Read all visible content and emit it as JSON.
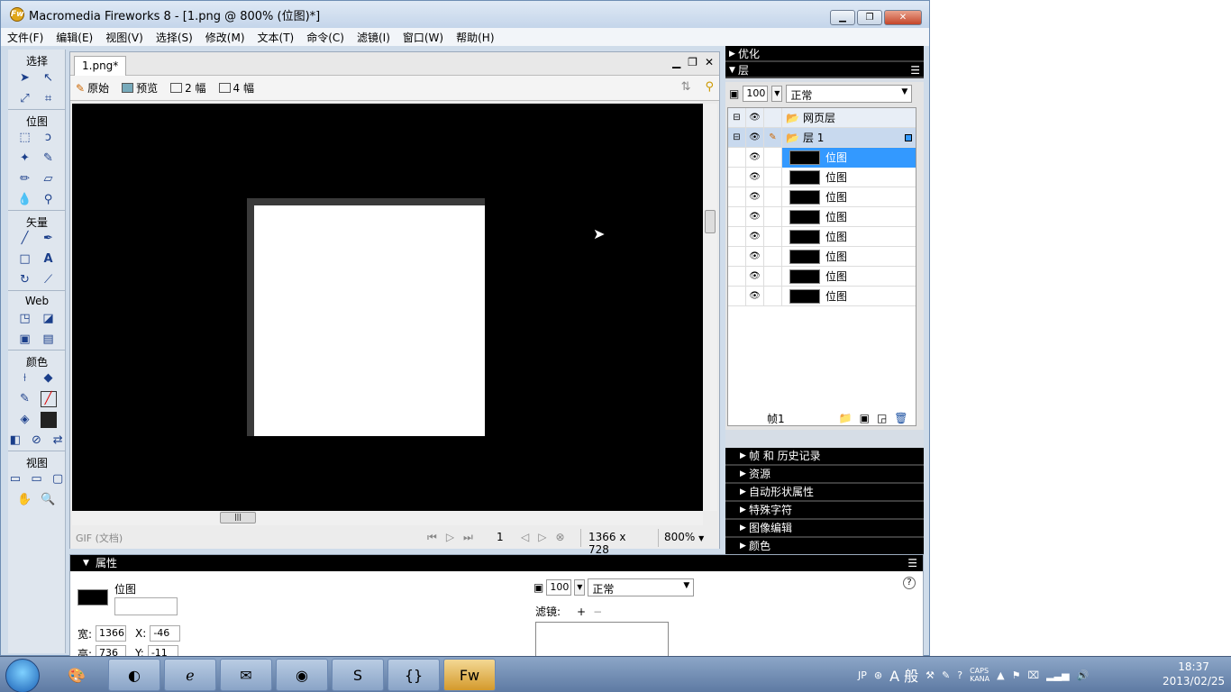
{
  "window": {
    "title": "Macromedia Fireworks 8 - [1.png @ 800% (位图)*]",
    "logo": "Fw"
  },
  "menus": [
    "文件(F)",
    "编辑(E)",
    "视图(V)",
    "选择(S)",
    "修改(M)",
    "文本(T)",
    "命令(C)",
    "滤镜(I)",
    "窗口(W)",
    "帮助(H)"
  ],
  "toolbox": {
    "sections": [
      "选择",
      "位图",
      "矢量",
      "Web",
      "颜色",
      "视图"
    ]
  },
  "document": {
    "tab": "1.png*",
    "views": [
      "原始",
      "预览",
      "2 幅",
      "4 幅"
    ],
    "status": {
      "type": "GIF (文档)",
      "frame": "1",
      "size": "1366 x 728",
      "zoom": "800%"
    }
  },
  "panels": {
    "optimize": "优化",
    "layers_title": "层",
    "opacity": "100",
    "blend": "正常",
    "web_layer": "网页层",
    "layer1": "层 1",
    "bitmap_label": "位图",
    "bitmaps": [
      "位图",
      "位图",
      "位图",
      "位图",
      "位图",
      "位图",
      "位图",
      "位图"
    ],
    "frame_label": "帧1",
    "collapsed": [
      "帧 和 历史记录",
      "资源",
      "自动形状属性",
      "特殊字符",
      "图像编辑",
      "颜色"
    ]
  },
  "properties": {
    "title": "属性",
    "name": "位图",
    "w_label": "宽:",
    "w": "1366",
    "h_label": "高:",
    "h": "736",
    "x_label": "X:",
    "x": "-46",
    "y_label": "Y:",
    "y": "-11",
    "opacity": "100",
    "blend": "正常",
    "filters_label": "滤镜:"
  },
  "taskbar": {
    "tray_lang": "JP",
    "ime": "A 般",
    "caps": "CAPS",
    "kana": "KANA",
    "time": "18:37",
    "date": "2013/02/25"
  }
}
